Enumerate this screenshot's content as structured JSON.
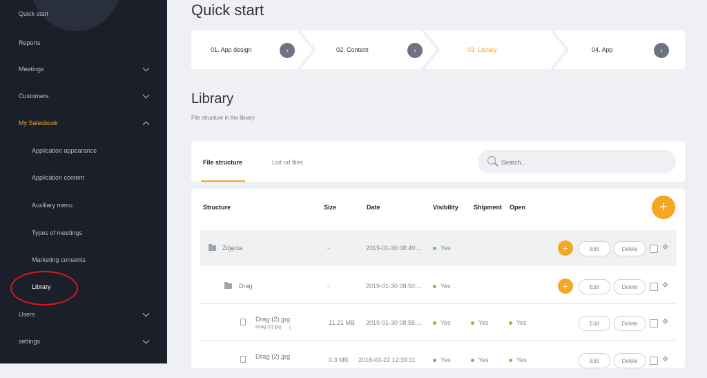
{
  "sidebar": {
    "items": [
      {
        "label": "Quick start"
      },
      {
        "label": "Reports"
      },
      {
        "label": "Meetings"
      },
      {
        "label": "Customers"
      },
      {
        "label": "My Salesbook"
      },
      {
        "label": "Users"
      },
      {
        "label": "settings"
      }
    ],
    "sub_items": [
      {
        "label": "Application appearance"
      },
      {
        "label": "Application content"
      },
      {
        "label": "Auxiliary menu"
      },
      {
        "label": "Types of meetings"
      },
      {
        "label": "Marketing consents"
      },
      {
        "label": "Library"
      }
    ]
  },
  "page": {
    "title": "Quick start",
    "steps": [
      {
        "label": "01. App design"
      },
      {
        "label": "02. Content"
      },
      {
        "label": "03. Library"
      },
      {
        "label": "04. App"
      }
    ],
    "section_title": "Library",
    "section_subtitle": "File structure in the library"
  },
  "tabs": [
    {
      "label": "File structure"
    },
    {
      "label": "List od files"
    }
  ],
  "search": {
    "placeholder": "Search..."
  },
  "table": {
    "headers": {
      "structure": "Structure",
      "size": "Size",
      "date": "Date",
      "visibility": "Visibility",
      "shipment": "Shipment",
      "open": "Open"
    },
    "rows": [
      {
        "name": "Zdjęcia",
        "size": "-",
        "date": "2019-01-30 08:49:...",
        "visibility": "Yes"
      },
      {
        "name": "Drag",
        "size": "-",
        "date": "2019-01-30 08:50:...",
        "visibility": "Yes"
      },
      {
        "name": "Drag (2).jpg",
        "subname": "Drag (2).jpg",
        "size": "11.21 MB",
        "date": "2019-01-30 08:55:...",
        "visibility": "Yes",
        "shipment": "Yes",
        "open": "Yes"
      },
      {
        "name": "Drag (2).jpg",
        "size": "0.3 MB",
        "date": "2018-03-22 12:39:11",
        "visibility": "Yes",
        "shipment": "Yes",
        "open": "Yes"
      }
    ],
    "edit_label": "Edit",
    "delete_label": "Delete"
  },
  "colors": {
    "accent": "#f5a623",
    "sidebar_bg": "#1b1f2a",
    "highlight_circle": "#e1151b",
    "status_dot": "#7bc142"
  }
}
